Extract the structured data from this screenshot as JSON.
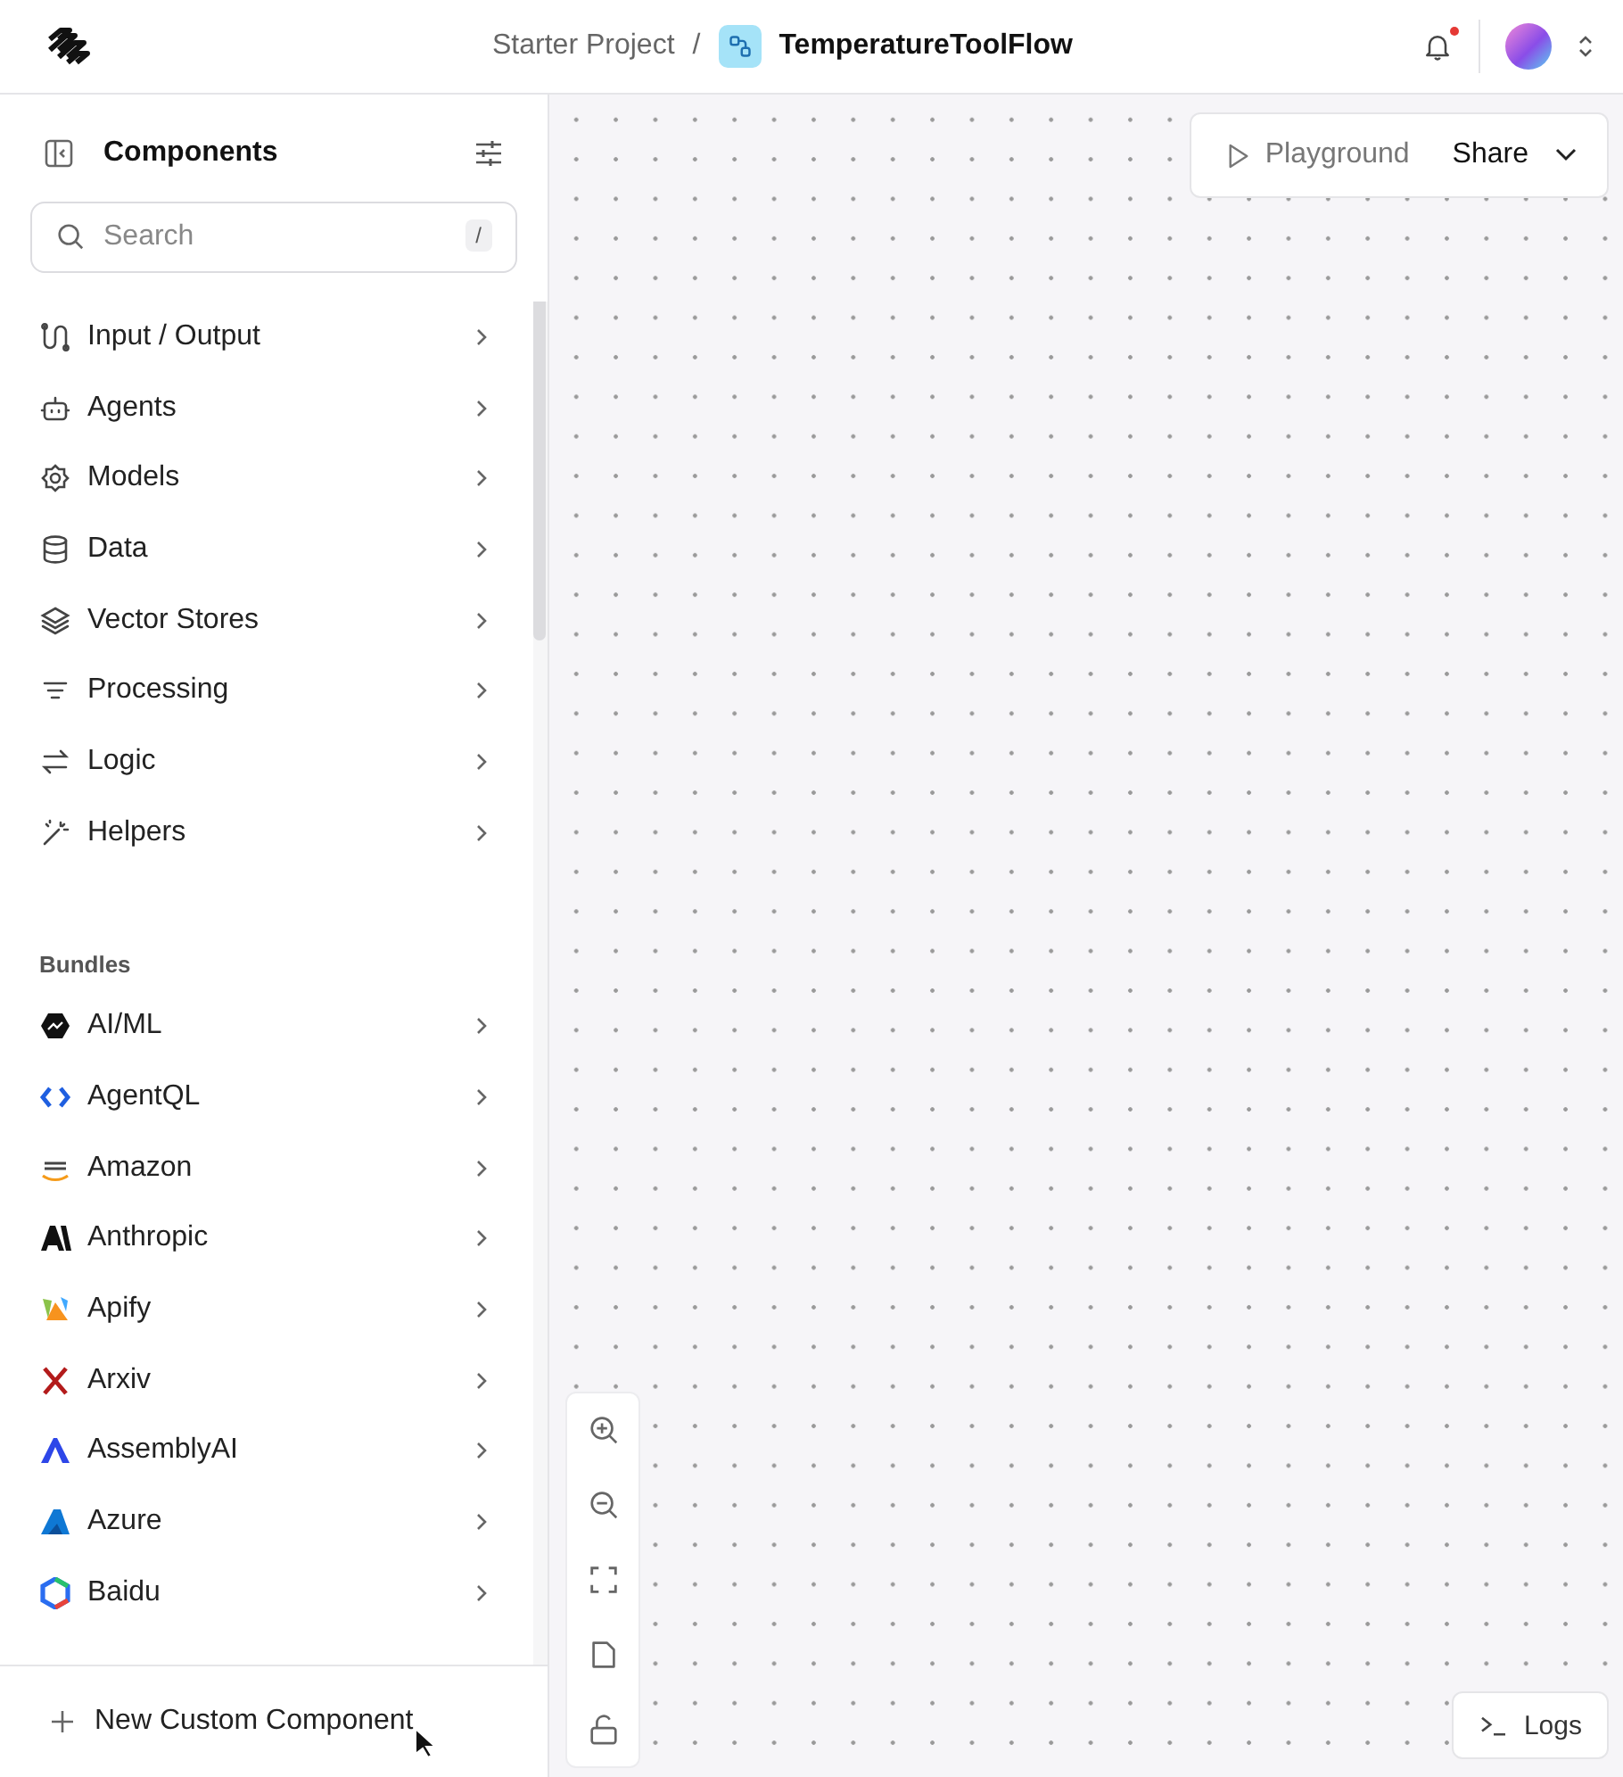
{
  "header": {
    "breadcrumb": "Starter Project",
    "separator": "/",
    "flow_name": "TemperatureToolFlow",
    "notification_unread": true
  },
  "sidebar": {
    "title": "Components",
    "search": {
      "placeholder": "Search",
      "shortcut": "/"
    },
    "categories": [
      {
        "label": "Input / Output"
      },
      {
        "label": "Agents"
      },
      {
        "label": "Models"
      },
      {
        "label": "Data"
      },
      {
        "label": "Vector Stores"
      },
      {
        "label": "Processing"
      },
      {
        "label": "Logic"
      },
      {
        "label": "Helpers"
      }
    ],
    "bundles_heading": "Bundles",
    "bundles": [
      {
        "label": "AI/ML"
      },
      {
        "label": "AgentQL"
      },
      {
        "label": "Amazon"
      },
      {
        "label": "Anthropic"
      },
      {
        "label": "Apify"
      },
      {
        "label": "Arxiv"
      },
      {
        "label": "AssemblyAI"
      },
      {
        "label": "Azure"
      },
      {
        "label": "Baidu"
      }
    ],
    "footer_button": "New Custom Component"
  },
  "canvas": {
    "playground": "Playground",
    "share": "Share",
    "logs": "Logs"
  }
}
